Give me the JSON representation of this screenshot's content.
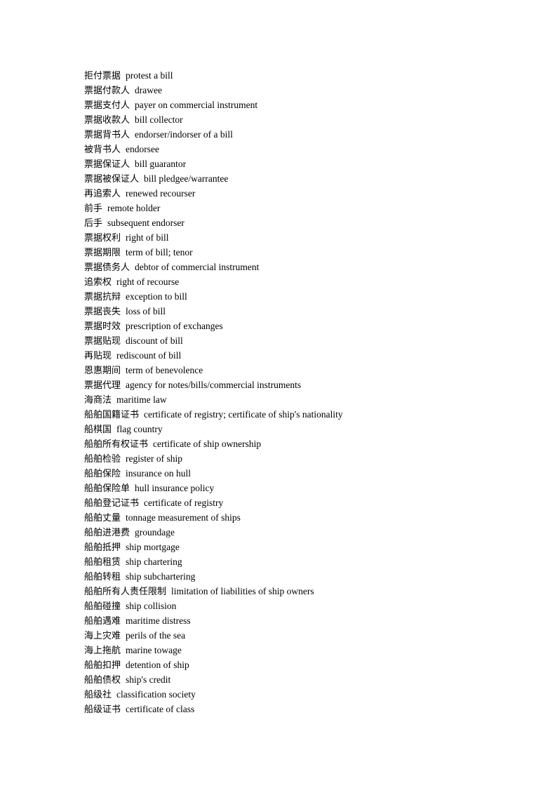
{
  "document": {
    "background_color": "#ffffff",
    "text_color": "#000000",
    "entries": [
      {
        "term": "拒付票据",
        "gloss": "protest a bill"
      },
      {
        "term": "票据付款人",
        "gloss": "drawee"
      },
      {
        "term": "票据支付人",
        "gloss": "payer on commercial instrument"
      },
      {
        "term": "票据收款人",
        "gloss": "bill collector"
      },
      {
        "term": "票据背书人",
        "gloss": "endorser/indorser of a bill"
      },
      {
        "term": "被背书人",
        "gloss": "endorsee"
      },
      {
        "term": "票据保证人",
        "gloss": "bill guarantor"
      },
      {
        "term": "票据被保证人",
        "gloss": "bill pledgee/warrantee"
      },
      {
        "term": "再追索人",
        "gloss": "renewed recourser"
      },
      {
        "term": "前手",
        "gloss": "remote holder"
      },
      {
        "term": "后手",
        "gloss": "subsequent endorser"
      },
      {
        "term": "票据权利",
        "gloss": "right of bill"
      },
      {
        "term": "票据期限",
        "gloss": "term of bill; tenor"
      },
      {
        "term": "票据债务人",
        "gloss": "debtor of commercial instrument"
      },
      {
        "term": "追索权",
        "gloss": "right of recourse"
      },
      {
        "term": "票据抗辩",
        "gloss": "exception to bill"
      },
      {
        "term": "票据丧失",
        "gloss": "loss of bill"
      },
      {
        "term": "票据时效",
        "gloss": "prescription of exchanges"
      },
      {
        "term": "票据贴现",
        "gloss": "discount of bill"
      },
      {
        "term": "再贴现",
        "gloss": "rediscount of bill"
      },
      {
        "term": "恩惠期间",
        "gloss": "term of benevolence"
      },
      {
        "term": "票据代理",
        "gloss": "agency for notes/bills/commercial instruments"
      },
      {
        "term": "海商法",
        "gloss": "maritime law"
      },
      {
        "term": "船舶国籍证书",
        "gloss": "certificate of registry; certificate of ship's nationality"
      },
      {
        "term": "船棋国",
        "gloss": "flag country"
      },
      {
        "term": "船舶所有权证书",
        "gloss": "certificate of ship ownership"
      },
      {
        "term": "船舶检验",
        "gloss": "register of ship"
      },
      {
        "term": "船舶保险",
        "gloss": "insurance on hull"
      },
      {
        "term": "船舶保险单",
        "gloss": "hull insurance policy"
      },
      {
        "term": "船舶登记证书",
        "gloss": "certificate of registry"
      },
      {
        "term": "船舶丈量",
        "gloss": "tonnage measurement of ships"
      },
      {
        "term": "船舶进港费",
        "gloss": "groundage"
      },
      {
        "term": "船舶抵押",
        "gloss": "ship mortgage"
      },
      {
        "term": "船舶租赁",
        "gloss": "ship chartering"
      },
      {
        "term": "船舶转租",
        "gloss": "ship subchartering"
      },
      {
        "term": "船舶所有人责任限制",
        "gloss": "limitation of liabilities of ship owners"
      },
      {
        "term": "船舶碰撞",
        "gloss": "ship collision"
      },
      {
        "term": "船舶遇难",
        "gloss": "maritime distress"
      },
      {
        "term": "海上灾难",
        "gloss": "perils of the sea"
      },
      {
        "term": "海上拖航",
        "gloss": "marine towage"
      },
      {
        "term": "船舶扣押",
        "gloss": "detention of ship"
      },
      {
        "term": "船舶债权",
        "gloss": "ship's credit"
      },
      {
        "term": "船级社",
        "gloss": "classification society"
      },
      {
        "term": "船级证书",
        "gloss": "certificate of class"
      }
    ]
  }
}
